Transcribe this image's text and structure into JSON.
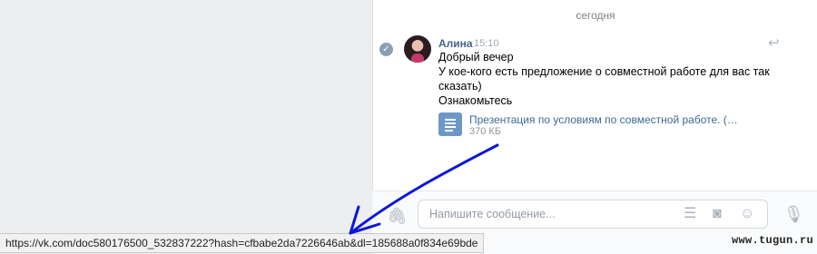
{
  "chat": {
    "date_separator": "сегодня",
    "message": {
      "author": "Алина",
      "time": "15:10",
      "lines": [
        "Добрый вечер",
        "У кое-кого есть предложение о совместной работе для вас так",
        "сказать)",
        "Ознакомьтесь"
      ],
      "attachment": {
        "name": "Презентация по условиям по совместной работе. (…",
        "size": "370 КБ"
      }
    }
  },
  "composer": {
    "placeholder": "Напишите сообщение..."
  },
  "status_bar": {
    "url": "https://vk.com/doc580176500_532837222?hash=cfbabe2da7226646ab&dl=185688a0f834e69bde"
  },
  "watermark": "www.tugun.ru",
  "colors": {
    "accent": "#42648b",
    "link": "#3b6998",
    "arrow": "#0b16d8"
  }
}
